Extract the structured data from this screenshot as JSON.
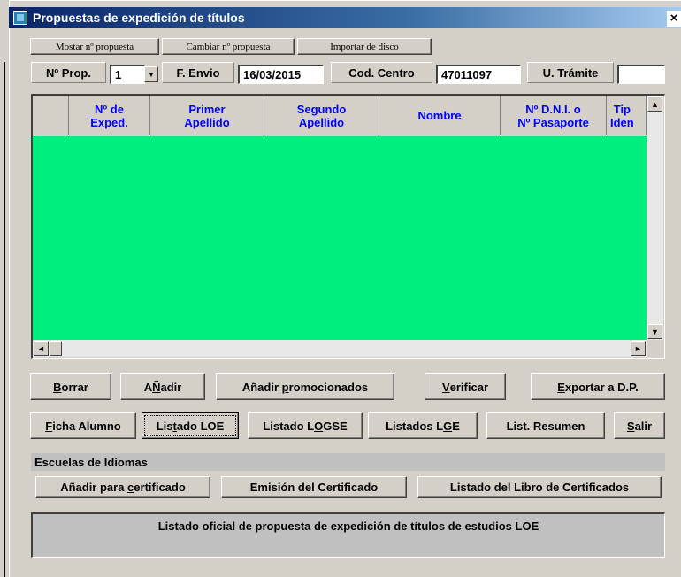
{
  "window": {
    "title": "Propuestas de expedición de títulos",
    "close_label": "×"
  },
  "top_buttons": [
    {
      "label": "Mostar nº propuesta"
    },
    {
      "label": "Cambiar nº propuesta"
    },
    {
      "label": "Importar de disco"
    }
  ],
  "fields": {
    "prop_label": "Nº Prop.",
    "prop_value": "1",
    "envio_label": "F. Envio",
    "envio_value": "16/03/2015",
    "centro_label": "Cod. Centro",
    "centro_value": "47011097",
    "tramite_label": "U. Trámite",
    "tramite_value": ""
  },
  "grid": {
    "columns": [
      {
        "label": ""
      },
      {
        "label": "Nº de\nExped."
      },
      {
        "label": "Primer\nApellido"
      },
      {
        "label": "Segundo\nApellido"
      },
      {
        "label": "Nombre"
      },
      {
        "label": "Nº D.N.I. o\nNº Pasaporte"
      },
      {
        "label": "Tip\nIden"
      }
    ],
    "rows": [],
    "body_color": "#00ee7e"
  },
  "action_row1": [
    {
      "accel": "B",
      "rest": "orrar"
    },
    {
      "accel": "Ñ",
      "rest": "adir",
      "prefix": "A"
    },
    {
      "prefix": "Añadir ",
      "accel": "p",
      "rest": "romocionados"
    },
    {
      "accel": "V",
      "rest": "erificar"
    },
    {
      "accel": "E",
      "rest": "xportar a D.P."
    }
  ],
  "action_row2": [
    {
      "accel": "F",
      "rest": "icha Alumno"
    },
    {
      "prefix": "Lis",
      "accel": "t",
      "rest": "ado LOE"
    },
    {
      "prefix": "Listado L",
      "accel": "O",
      "rest": "GSE"
    },
    {
      "prefix": "Listados L",
      "accel": "G",
      "rest": "E"
    },
    {
      "prefix": "List. Resumen",
      "accel": "",
      "rest": ""
    },
    {
      "accel": "S",
      "rest": "alir"
    }
  ],
  "idiomas": {
    "section_label": "Escuelas de Idiomas",
    "buttons": [
      {
        "prefix": "Añadir para ",
        "accel": "c",
        "rest": "ertificado"
      },
      {
        "prefix": "Emisión del Certificado",
        "accel": "",
        "rest": ""
      },
      {
        "prefix": "Listado del Libro de Certificados",
        "accel": "",
        "rest": ""
      }
    ]
  },
  "status_text": "Listado oficial de propuesta de expedición de títulos de estudios LOE",
  "icons": {
    "dropdown": "▼",
    "scroll_up": "▲",
    "scroll_down": "▼",
    "scroll_left": "◄",
    "scroll_right": "►"
  }
}
